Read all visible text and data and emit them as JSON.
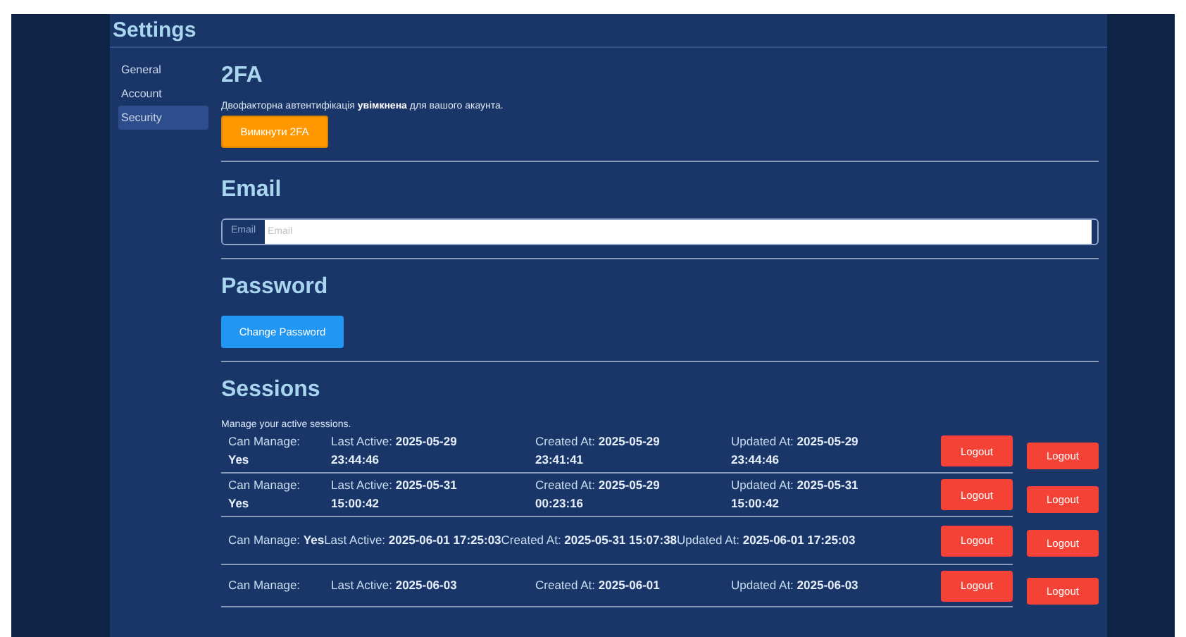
{
  "title": "Settings",
  "sidebar": {
    "items": [
      {
        "label": "General",
        "selected": false
      },
      {
        "label": "Account",
        "selected": false
      },
      {
        "label": "Security",
        "selected": true
      }
    ]
  },
  "two_fa": {
    "heading": "2FA",
    "status_text": "Двофакторна автентифікація **увімкнена** для вашого акаунта.",
    "button": "Вимкнути 2FA"
  },
  "email": {
    "heading": "Email",
    "label": "Email",
    "placeholder": "Email"
  },
  "password": {
    "heading": "Password",
    "button": "Change Password"
  },
  "sessions": {
    "heading": "Sessions",
    "description": "Manage your active sessions.",
    "rows": [
      {
        "kind": "stacked",
        "fields": [
          {
            "label": "Can Manage:",
            "value": "Yes"
          },
          {
            "label": "Last Active:",
            "value": "2025-05-29 23:44:46"
          },
          {
            "label": "Created At:",
            "value": "2025-05-29 23:41:41"
          },
          {
            "label": "Updated At:",
            "value": "2025-05-29 23:44:46"
          }
        ],
        "buttons": [
          "Logout",
          "Logout"
        ]
      },
      {
        "kind": "stacked",
        "fields": [
          {
            "label": "Can Manage:",
            "value": "Yes"
          },
          {
            "label": "Last Active:",
            "value": "2025-05-31 15:00:42"
          },
          {
            "label": "Created At:",
            "value": "2025-05-29 00:23:16"
          },
          {
            "label": "Updated At:",
            "value": "2025-05-31 15:00:42"
          }
        ],
        "buttons": [
          "Logout",
          "Logout"
        ]
      },
      {
        "kind": "inline",
        "fields": [
          {
            "label": "Can Manage:",
            "value": "Yes"
          },
          {
            "label": "Last Active:",
            "value": "2025-06-01 17:25:03"
          },
          {
            "label": "Created At:",
            "value": "2025-05-31 15:07:38"
          },
          {
            "label": "Updated At:",
            "value": "2025-06-01 17:25:03"
          }
        ],
        "buttons": [
          "Logout",
          "Logout"
        ]
      },
      {
        "kind": "stacked",
        "fields": [
          {
            "label": "Can Manage:"
          },
          {
            "label": "Last Active:",
            "value": "2025-06-03"
          },
          {
            "label": "Created At:",
            "value": "2025-06-01"
          },
          {
            "label": "Updated At:",
            "value": "2025-06-03"
          }
        ],
        "buttons": [
          "Logout",
          "Logout"
        ]
      }
    ]
  }
}
